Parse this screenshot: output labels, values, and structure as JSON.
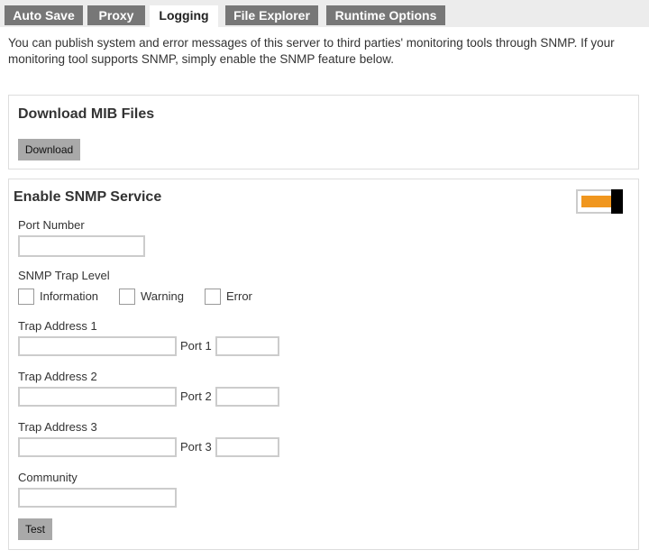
{
  "tabs": [
    {
      "label": "Auto Save"
    },
    {
      "label": "Proxy"
    },
    {
      "label": "Logging",
      "active": true
    },
    {
      "label": "File Explorer"
    },
    {
      "label": "Runtime Options"
    }
  ],
  "intro": "You can publish system and error messages of this server to third parties' monitoring tools through SNMP. If your monitoring tool supports SNMP, simply enable the SNMP feature below.",
  "mib": {
    "title": "Download MIB Files",
    "download_label": "Download"
  },
  "snmp": {
    "title": "Enable SNMP Service",
    "enabled": true,
    "accent_color": "#f0961e",
    "port_label": "Port Number",
    "port_value": "",
    "trap_level_label": "SNMP Trap Level",
    "levels": [
      {
        "label": "Information",
        "checked": false
      },
      {
        "label": "Warning",
        "checked": false
      },
      {
        "label": "Error",
        "checked": false
      }
    ],
    "traps": [
      {
        "label": "Trap Address 1",
        "port_label": "Port 1",
        "address": "",
        "port": ""
      },
      {
        "label": "Trap Address 2",
        "port_label": "Port 2",
        "address": "",
        "port": ""
      },
      {
        "label": "Trap Address 3",
        "port_label": "Port 3",
        "address": "",
        "port": ""
      }
    ],
    "community_label": "Community",
    "community_value": "",
    "test_label": "Test"
  }
}
